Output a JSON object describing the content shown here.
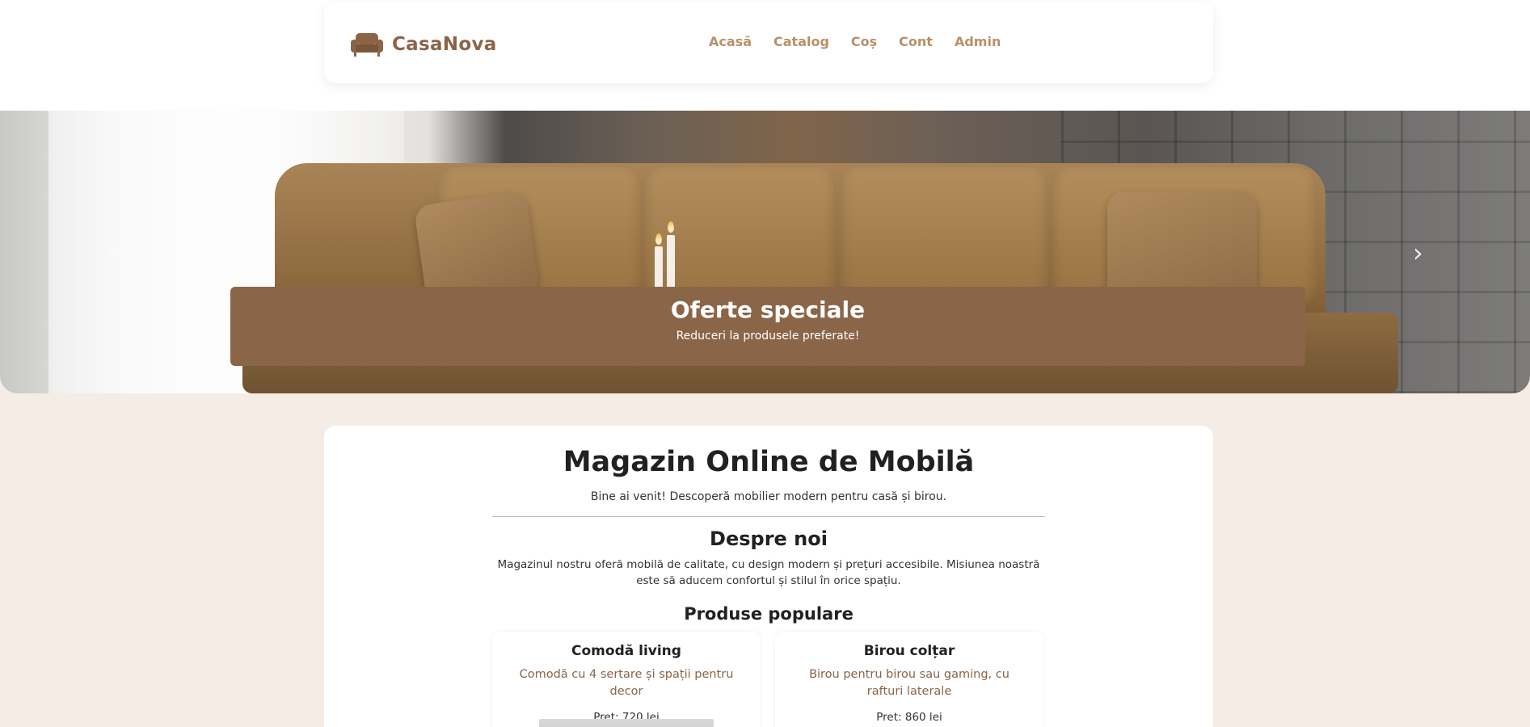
{
  "brand": {
    "name": "CasaNova",
    "logo_icon": "sofa-icon"
  },
  "nav": {
    "links": [
      {
        "label": "Acasă"
      },
      {
        "label": "Catalog"
      },
      {
        "label": "Coș"
      },
      {
        "label": "Cont"
      },
      {
        "label": "Admin"
      }
    ]
  },
  "hero": {
    "title": "Oferte speciale",
    "subtitle": "Reduceri la produsele preferate!",
    "prev_icon": "chevron-left-icon",
    "next_icon": "chevron-right-icon"
  },
  "main": {
    "title": "Magazin Online de Mobilă",
    "welcome": "Bine ai venit! Descoperă mobilier modern pentru casă și birou.",
    "about_title": "Despre noi",
    "about_text": "Magazinul nostru oferă mobilă de calitate, cu design modern și prețuri accesibile. Misiunea noastră este să aducem confortul și stilul în orice spațiu.",
    "products_title": "Produse populare",
    "products": [
      {
        "name": "Comodă living",
        "description": "Comodă cu 4 sertare și spații pentru decor",
        "price": "Pret: 720 lei"
      },
      {
        "name": "Birou colțar",
        "description": "Birou pentru birou sau gaming, cu rafturi laterale",
        "price": "Pret: 860 lei"
      }
    ]
  },
  "colors": {
    "brand": "#8b6448",
    "nav_link": "#b99069",
    "caption_bg": "#8b6548",
    "page_bg": "#f4ece5"
  }
}
